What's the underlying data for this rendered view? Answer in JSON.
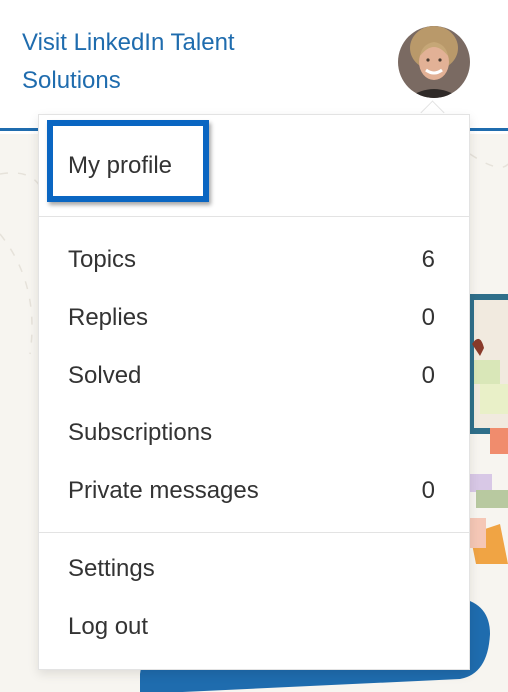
{
  "header": {
    "talent_link": "Visit LinkedIn Talent Solutions"
  },
  "menu": {
    "profile_label": "My profile",
    "items": [
      {
        "label": "Topics",
        "count": "6"
      },
      {
        "label": "Replies",
        "count": "0"
      },
      {
        "label": "Solved",
        "count": "0"
      },
      {
        "label": "Subscriptions",
        "count": ""
      },
      {
        "label": "Private messages",
        "count": "0"
      }
    ],
    "settings_label": "Settings",
    "logout_label": "Log out"
  },
  "colors": {
    "link_blue": "#1f6cae",
    "highlight_blue": "#0a66c2",
    "text": "#333333",
    "backdrop": "#f7f5f0"
  },
  "icons": {
    "avatar": "user-avatar-photo"
  }
}
